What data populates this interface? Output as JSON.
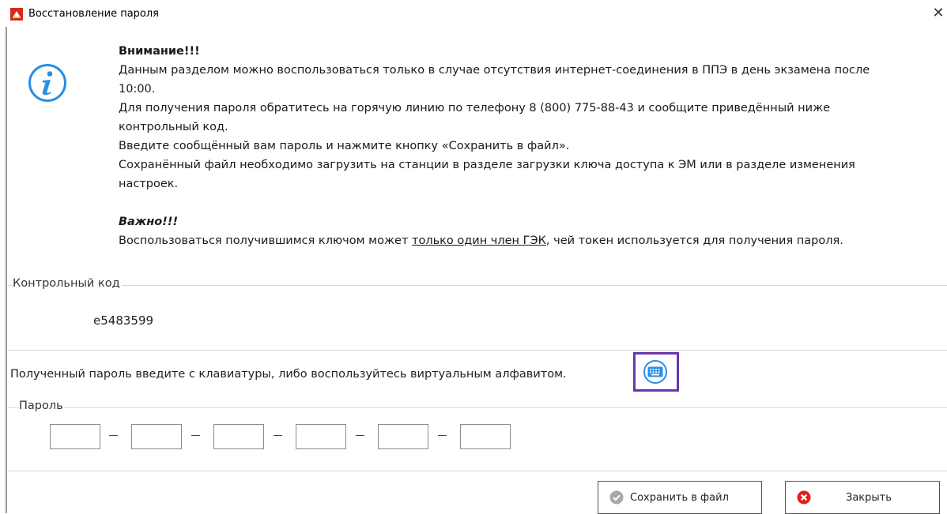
{
  "window": {
    "title": "Восстановление пароля",
    "close_label": "✕"
  },
  "info": {
    "attention_heading": "Внимание!!!",
    "line1": "Данным разделом можно воспользоваться только в случае отсутствия интернет-соединения в ППЭ в день экзамена после",
    "line1b": "10:00.",
    "line2": "Для получения пароля обратитесь на горячую линию по телефону 8 (800) 775-88-43 и сообщите приведённый ниже",
    "line2b": "контрольный код.",
    "line3": "Введите сообщённый вам пароль и нажмите кнопку «Сохранить в файл».",
    "line4": "Сохранённый файл необходимо загрузить на станции в разделе загрузки ключа доступа к ЭМ или в разделе изменения",
    "line4b": "настроек.",
    "important_heading": "Важно!!!",
    "important_pre": "Воспользоваться получившимся ключом может ",
    "important_link": "только один член ГЭК",
    "important_post": ", чей токен используется для получения пароля."
  },
  "control_code": {
    "label": "Контрольный код",
    "value": "e5483599"
  },
  "password": {
    "hint": "Полученный пароль введите с клавиатуры, либо воспользуйтесь виртуальным алфавитом.",
    "label": "Пароль",
    "segments": [
      "",
      "",
      "",
      "",
      "",
      ""
    ]
  },
  "buttons": {
    "save_label": "Сохранить в файл",
    "close_label": "Закрыть"
  },
  "colors": {
    "accent_blue": "#2a8ee3",
    "highlight_purple": "#6a37a8",
    "close_red": "#e02020",
    "save_gray": "#a8a8a8"
  }
}
